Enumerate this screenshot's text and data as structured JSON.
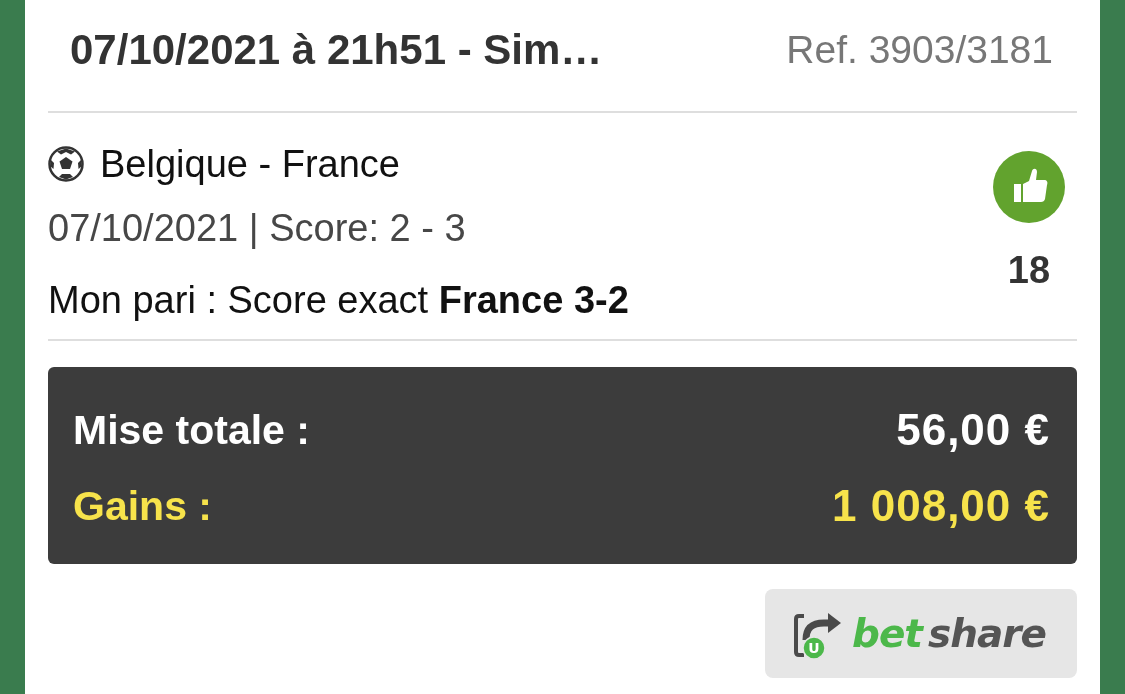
{
  "header": {
    "title": "07/10/2021 à 21h51 - Sim…",
    "reference": "Ref. 3903/3181"
  },
  "selections": [
    {
      "match": "Belgique - France",
      "details": "07/10/2021 | Score: 2 - 3",
      "bet": "Mon pari : Score exact **France 3-2**",
      "won": true,
      "odds": "18"
    }
  ],
  "summary": [
    {
      "kind": "stake",
      "label": "Mise totale :",
      "value": "56,00 €"
    },
    {
      "kind": "winnings",
      "label": "Gains :",
      "value": "1 008,00 €"
    }
  ],
  "share_button": {
    "icon_letter": "U",
    "brand": [
      {
        "text": "bet",
        "color": "#4cb84a"
      },
      {
        "text": "share",
        "color": "#555555"
      }
    ]
  }
}
